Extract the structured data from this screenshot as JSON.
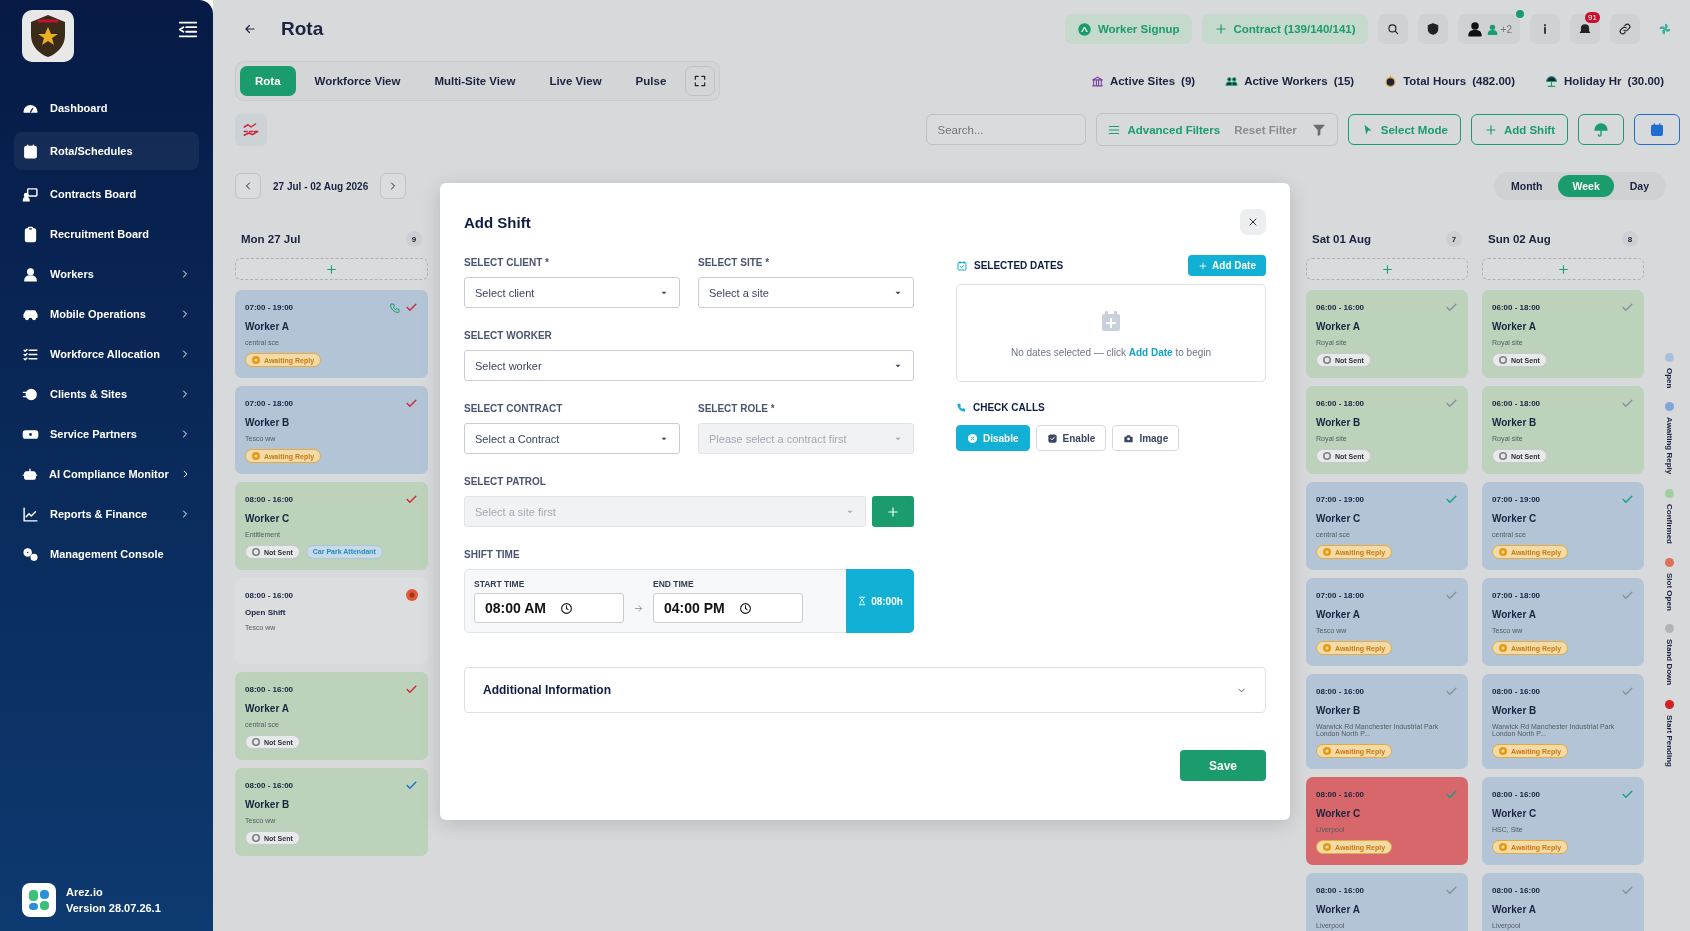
{
  "sidebar": {
    "brand": "Arez.io",
    "version": "Version 28.07.26.1",
    "items": [
      {
        "label": "Dashboard",
        "selected": false,
        "expandable": false
      },
      {
        "label": "Rota/Schedules",
        "selected": true,
        "expandable": false
      },
      {
        "label": "Contracts Board",
        "selected": false,
        "expandable": false
      },
      {
        "label": "Recruitment Board",
        "selected": false,
        "expandable": false
      },
      {
        "label": "Workers",
        "selected": false,
        "expandable": true
      },
      {
        "label": "Mobile Operations",
        "selected": false,
        "expandable": true
      },
      {
        "label": "Workforce Allocation",
        "selected": false,
        "expandable": true
      },
      {
        "label": "Clients & Sites",
        "selected": false,
        "expandable": true
      },
      {
        "label": "Service Partners",
        "selected": false,
        "expandable": true
      },
      {
        "label": "AI Compliance Monitor",
        "selected": false,
        "expandable": true
      },
      {
        "label": "Reports & Finance",
        "selected": false,
        "expandable": true
      },
      {
        "label": "Management Console",
        "selected": false,
        "expandable": false
      }
    ]
  },
  "header": {
    "title": "Rota",
    "buttons": [
      "Worker Signup",
      "Contract (139/140/141)"
    ],
    "notification_count": "91",
    "avatar_extra": "+2"
  },
  "tabs": [
    {
      "label": "Rota",
      "selected": true
    },
    {
      "label": "Workforce View",
      "selected": false
    },
    {
      "label": "Multi-Site View",
      "selected": false
    },
    {
      "label": "Live View",
      "selected": false
    },
    {
      "label": "Pulse",
      "selected": false
    }
  ],
  "stats": [
    {
      "kind": "sites",
      "label": "Active Sites",
      "value": "(9)"
    },
    {
      "kind": "workers",
      "label": "Active Workers",
      "value": "(15)"
    },
    {
      "kind": "hours",
      "label": "Total Hours",
      "value": "(482.00)"
    },
    {
      "kind": "holiday",
      "label": "Holiday Hr",
      "value": "(30.00)"
    }
  ],
  "toolbar": {
    "search_placeholder": "Search...",
    "advanced_filters": "Advanced Filters",
    "reset_filter": "Reset Filter",
    "select_mode": "Select Mode",
    "add_shift": "Add Shift"
  },
  "date_range": "27 Jul - 02 Aug 2026",
  "views": [
    {
      "label": "Month",
      "selected": false
    },
    {
      "label": "Week",
      "selected": true
    },
    {
      "label": "Day",
      "selected": false
    }
  ],
  "days": [
    {
      "title": "Mon 27 Jul",
      "count": "9",
      "shifts": [
        {
          "time": "07:00 - 19:00",
          "worker": "Worker A",
          "site": "central sce",
          "color": "#b2c4d6",
          "marker": {
            "kind": "check",
            "color": "#d0263b"
          },
          "phone": true,
          "open": false,
          "badge": {
            "kind": "awaiting",
            "label": "Awaiting Reply"
          }
        },
        {
          "time": "07:00 - 18:00",
          "worker": "Worker B",
          "site": "Tesco ww",
          "color": "#b2c4d6",
          "marker": {
            "kind": "check",
            "color": "#d0263b"
          },
          "phone": false,
          "open": false,
          "badge": {
            "kind": "awaiting",
            "label": "Awaiting Reply"
          }
        },
        {
          "time": "08:00 - 16:00",
          "worker": "Worker C",
          "site": "Entitlement",
          "color": "#bcd2bb",
          "marker": {
            "kind": "check",
            "color": "#d0263b"
          },
          "phone": false,
          "open": false,
          "badge": {
            "kind": "not-sent",
            "label": "Not Sent"
          },
          "tag": "Car Park Attendant"
        },
        {
          "time": "08:00 - 16:00",
          "worker": "Open Shift",
          "site": "Tesco ww",
          "color": "#dcdddf",
          "marker": {
            "kind": "alert",
            "color": "#e05a3a"
          },
          "phone": false,
          "open": true
        },
        {
          "time": "08:00 - 16:00",
          "worker": "Worker A",
          "site": "central sce",
          "color": "#bcd2bb",
          "marker": {
            "kind": "check",
            "color": "#d0263b"
          },
          "phone": false,
          "open": false,
          "badge": {
            "kind": "not-sent",
            "label": "Not Sent"
          }
        },
        {
          "time": "08:00 - 16:00",
          "worker": "Worker B",
          "site": "Tesco ww",
          "color": "#bcd2bb",
          "marker": {
            "kind": "check",
            "color": "#1f6fd1"
          },
          "phone": false,
          "open": false,
          "badge": {
            "kind": "not-sent",
            "label": "Not Sent"
          }
        }
      ]
    },
    {
      "title": "Sat 01 Aug",
      "count": "7",
      "shifts": [
        {
          "time": "06:00 - 16:00",
          "worker": "Worker A",
          "site": "Royal site",
          "color": "#bcd2bb",
          "marker": {
            "kind": "check",
            "color": "#8a8f96"
          },
          "phone": false,
          "open": false,
          "badge": {
            "kind": "not-sent",
            "label": "Not Sent"
          }
        },
        {
          "time": "06:00 - 18:00",
          "worker": "Worker B",
          "site": "Royal site",
          "color": "#bcd2bb",
          "marker": {
            "kind": "check",
            "color": "#8a8f96"
          },
          "phone": false,
          "open": false,
          "badge": {
            "kind": "not-sent",
            "label": "Not Sent"
          }
        },
        {
          "time": "07:00 - 19:00",
          "worker": "Worker C",
          "site": "central sce",
          "color": "#b2c4d6",
          "marker": {
            "kind": "check",
            "color": "#1a9c8a"
          },
          "phone": false,
          "open": false,
          "badge": {
            "kind": "awaiting",
            "label": "Awaiting Reply"
          }
        },
        {
          "time": "07:00 - 18:00",
          "worker": "Worker A",
          "site": "Tesco ww",
          "color": "#b2c4d6",
          "marker": {
            "kind": "check",
            "color": "#8a8f96"
          },
          "phone": false,
          "open": false,
          "badge": {
            "kind": "awaiting",
            "label": "Awaiting Reply"
          }
        },
        {
          "time": "08:00 - 16:00",
          "worker": "Worker B",
          "site": "Warwick Rd Manchester Industrial Park London North P...",
          "color": "#b2c4d6",
          "marker": {
            "kind": "check",
            "color": "#8a8f96"
          },
          "phone": false,
          "open": false,
          "badge": {
            "kind": "awaiting",
            "label": "Awaiting Reply"
          }
        },
        {
          "time": "08:00 - 16:00",
          "worker": "Worker C",
          "site": "Liverpool",
          "color": "#d8676b",
          "marker": {
            "kind": "check",
            "color": "#1a9c8a"
          },
          "phone": false,
          "open": false,
          "badge": {
            "kind": "awaiting",
            "label": "Awaiting Reply"
          }
        },
        {
          "time": "08:00 - 16:00",
          "worker": "Worker A",
          "site": "Liverpool",
          "color": "#b2c4d6",
          "marker": {
            "kind": "check",
            "color": "#8a8f96"
          },
          "phone": false,
          "open": false
        }
      ]
    },
    {
      "title": "Sun 02 Aug",
      "count": "8",
      "shifts": [
        {
          "time": "06:00 - 18:00",
          "worker": "Worker A",
          "site": "Royal site",
          "color": "#bcd2bb",
          "marker": {
            "kind": "check",
            "color": "#8a8f96"
          },
          "phone": false,
          "open": false,
          "badge": {
            "kind": "not-sent",
            "label": "Not Sent"
          }
        },
        {
          "time": "06:00 - 18:00",
          "worker": "Worker B",
          "site": "Royal site",
          "color": "#bcd2bb",
          "marker": {
            "kind": "check",
            "color": "#8a8f96"
          },
          "phone": false,
          "open": false,
          "badge": {
            "kind": "not-sent",
            "label": "Not Sent"
          }
        },
        {
          "time": "07:00 - 19:00",
          "worker": "Worker C",
          "site": "central sce",
          "color": "#b2c4d6",
          "marker": {
            "kind": "check",
            "color": "#1a9c8a"
          },
          "phone": false,
          "open": false,
          "badge": {
            "kind": "awaiting",
            "label": "Awaiting Reply"
          }
        },
        {
          "time": "07:00 - 18:00",
          "worker": "Worker A",
          "site": "Tesco ww",
          "color": "#b2c4d6",
          "marker": {
            "kind": "check",
            "color": "#8a8f96"
          },
          "phone": false,
          "open": false,
          "badge": {
            "kind": "awaiting",
            "label": "Awaiting Reply"
          }
        },
        {
          "time": "08:00 - 16:00",
          "worker": "Worker B",
          "site": "Warwick Rd Manchester Industrial Park London North P...",
          "color": "#b2c4d6",
          "marker": {
            "kind": "check",
            "color": "#8a8f96"
          },
          "phone": false,
          "open": false,
          "badge": {
            "kind": "awaiting",
            "label": "Awaiting Reply"
          }
        },
        {
          "time": "08:00 - 16:00",
          "worker": "Worker C",
          "site": "HSC, Site",
          "color": "#b2c4d6",
          "marker": {
            "kind": "check",
            "color": "#1a9c8a"
          },
          "phone": false,
          "open": false,
          "badge": {
            "kind": "awaiting",
            "label": "Awaiting Reply"
          }
        },
        {
          "time": "08:00 - 16:00",
          "worker": "Worker A",
          "site": "Liverpool",
          "color": "#b2c4d6",
          "marker": {
            "kind": "check",
            "color": "#8a8f96"
          },
          "phone": false,
          "open": false
        }
      ]
    }
  ],
  "legend": [
    {
      "label": "Open",
      "color": "#a9c0dc"
    },
    {
      "label": "Awaiting Reply",
      "color": "#7fa6d6"
    },
    {
      "label": "Confirmed",
      "color": "#9fcf9c"
    },
    {
      "label": "Slot Open",
      "color": "#e0705a"
    },
    {
      "label": "Stand Down",
      "color": "#b4b4b4"
    },
    {
      "label": "Start Pending",
      "color": "#d21f1f"
    }
  ],
  "modal": {
    "title": "Add Shift",
    "fields": [
      {
        "label": "SELECT CLIENT *",
        "placeholder": "Select client",
        "disabled": false,
        "kind": "half"
      },
      {
        "label": "SELECT SITE *",
        "placeholder": "Select a site",
        "disabled": false,
        "kind": "half"
      },
      {
        "label": "SELECT WORKER",
        "placeholder": "Select worker",
        "disabled": false,
        "kind": "full"
      },
      {
        "label": "SELECT CONTRACT",
        "placeholder": "Select a Contract",
        "disabled": false,
        "kind": "half"
      },
      {
        "label": "SELECT ROLE *",
        "placeholder": "Please select a contract first",
        "disabled": true,
        "kind": "half"
      },
      {
        "label": "SELECT PATROL",
        "placeholder": "Select a site first",
        "disabled": true,
        "kind": "add"
      }
    ],
    "shift_time": {
      "label": "SHIFT TIME",
      "start_label": "START TIME",
      "start": "08:00 AM",
      "end_label": "END TIME",
      "end": "04:00 PM",
      "duration": "08:00h"
    },
    "selected_dates": {
      "title": "SELECTED DATES",
      "add_button": "Add Date",
      "empty_text": "No dates selected — click **Add Date** to begin"
    },
    "check_calls": {
      "title": "CHECK CALLS",
      "options": [
        {
          "kind": "disable",
          "label": "Disable",
          "selected": true
        },
        {
          "kind": "enable",
          "label": "Enable",
          "selected": false
        },
        {
          "kind": "image",
          "label": "Image",
          "selected": false
        }
      ]
    },
    "additional": {
      "label": "Additional Information",
      "expanded": false
    },
    "save": "Save"
  }
}
